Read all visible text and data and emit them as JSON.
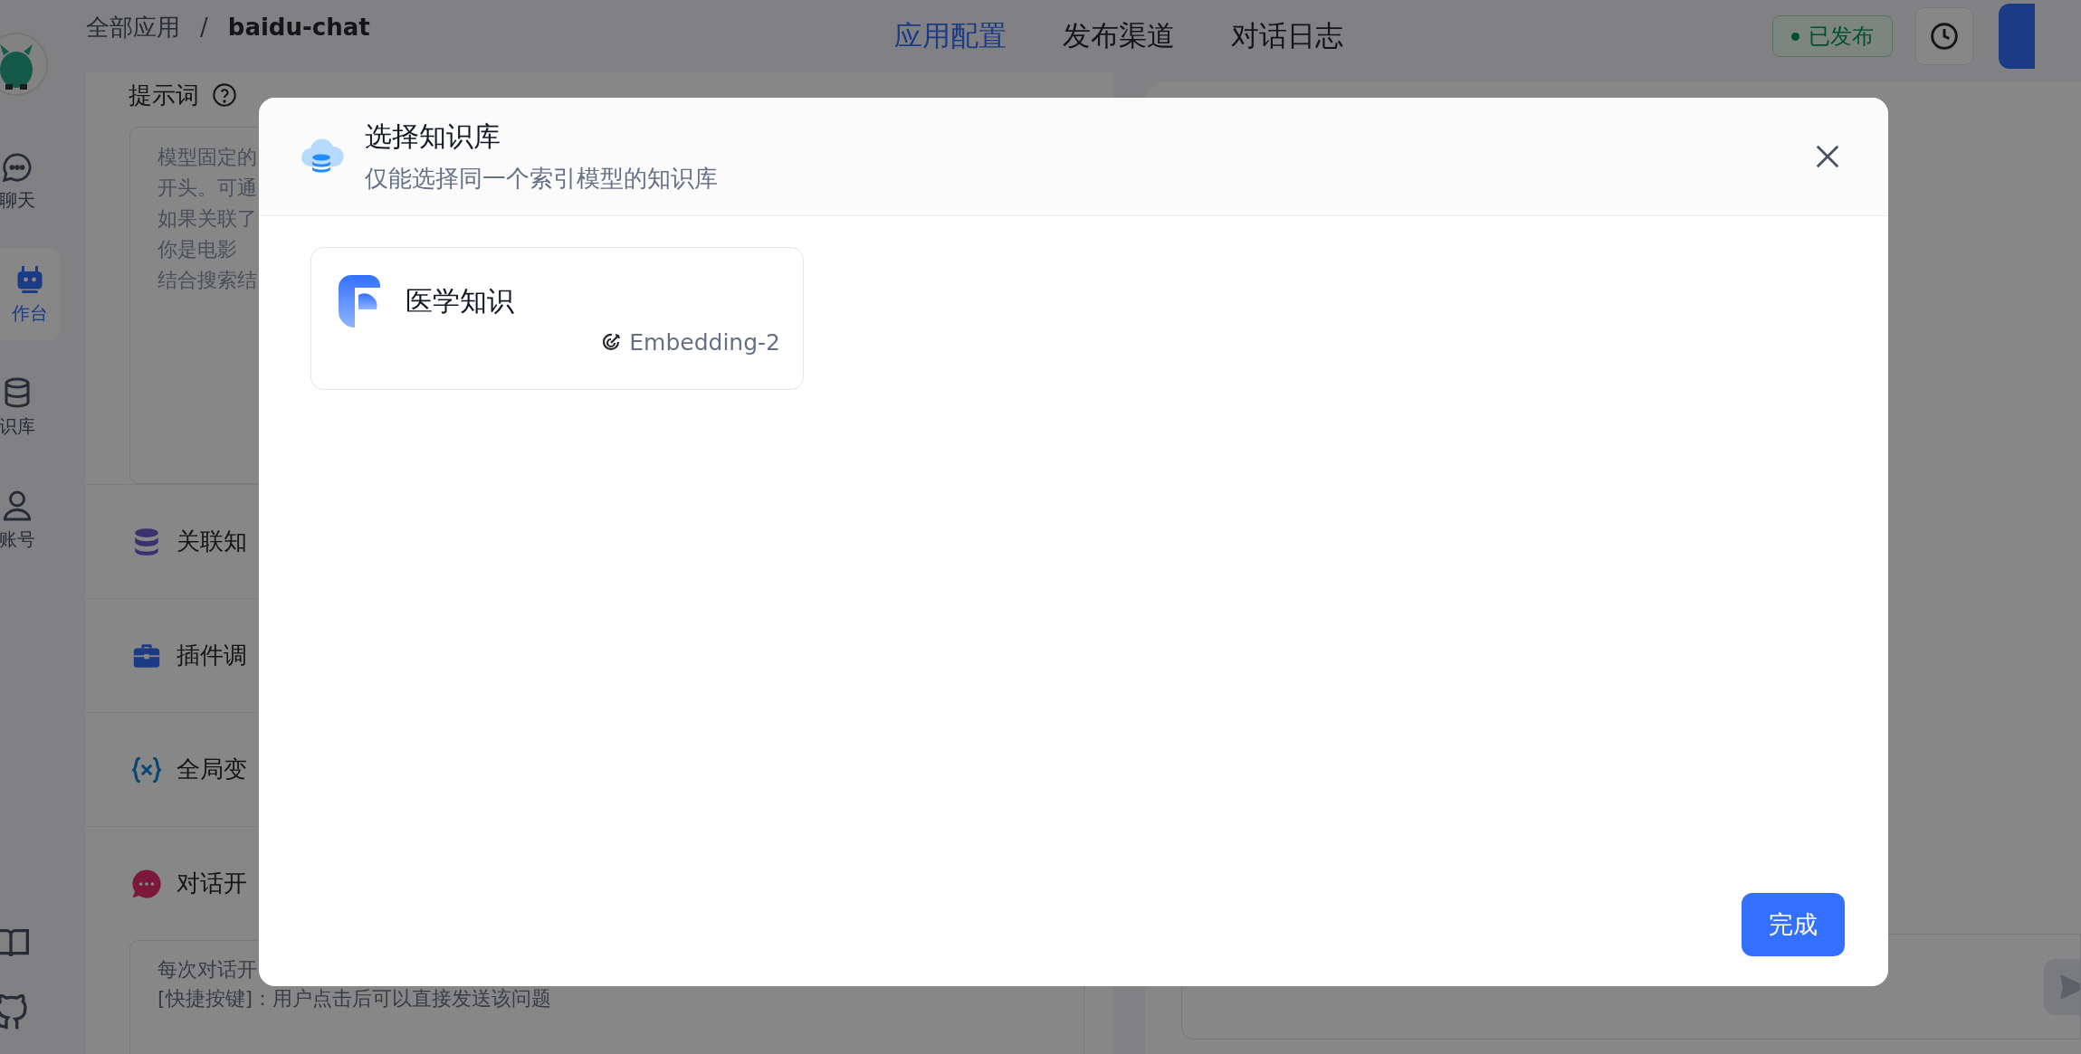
{
  "sidebar": {
    "items": [
      {
        "kind": "chat",
        "label": "聊天",
        "selected": false
      },
      {
        "kind": "robot",
        "label": "作台",
        "selected": true
      },
      {
        "kind": "database",
        "label": "识库",
        "selected": false
      },
      {
        "kind": "user",
        "label": "账号",
        "selected": false
      }
    ]
  },
  "header": {
    "breadcrumb": {
      "parent": "全部应用",
      "separator": "/",
      "current": "baidu-chat"
    },
    "tabs": [
      {
        "label": "应用配置",
        "selected": true
      },
      {
        "label": "发布渠道",
        "selected": false
      },
      {
        "label": "对话日志",
        "selected": false
      }
    ],
    "status_badge": "已发布"
  },
  "prompt_section": {
    "title": "提示词",
    "placeholder_lines": [
      "模型固定的",
      "开头。可通",
      "如果关联了",
      "你是电影",
      "结合搜索结"
    ]
  },
  "sections": [
    {
      "kind": "dataset",
      "label": "关联知"
    },
    {
      "kind": "plugin",
      "label": "插件调"
    },
    {
      "kind": "variable",
      "label": "全局变"
    },
    {
      "kind": "opening",
      "label": "对话开"
    }
  ],
  "opening_box": {
    "lines": [
      "每次对话开",
      "[快捷按键]：用户点击后可以直接发送该问题"
    ]
  },
  "modal": {
    "title": "选择知识库",
    "subtitle": "仅能选择同一个索引模型的知识库",
    "datasets": [
      {
        "name": "医学知识",
        "model": "Embedding-2"
      }
    ],
    "confirm": "完成"
  }
}
